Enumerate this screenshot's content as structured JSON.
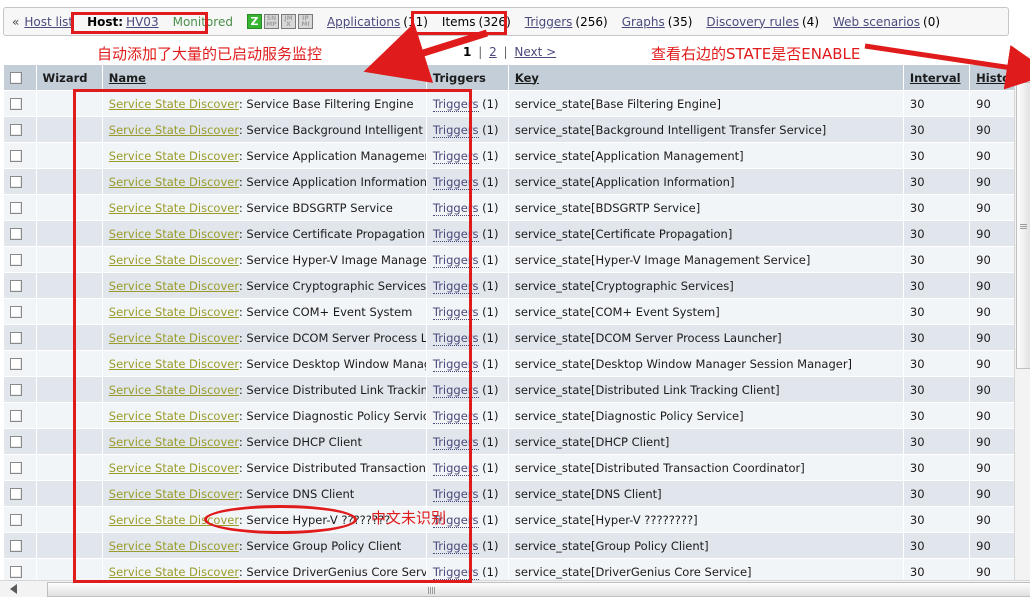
{
  "nav": {
    "back_chevron": "«",
    "host_list": "Host list",
    "host_label": "Host:",
    "host_name": "HV03",
    "monitored": "Monitored",
    "icons": [
      {
        "name": "zbx-icon",
        "label": "Z",
        "active": true
      },
      {
        "name": "snmp-icon",
        "label": "SNMP",
        "active": false
      },
      {
        "name": "jmx-icon",
        "label": "JMX",
        "active": false
      },
      {
        "name": "ipmi-icon",
        "label": "IPMI",
        "active": false
      }
    ],
    "tabs": [
      {
        "label": "Applications",
        "count": "(11)"
      },
      {
        "label": "Items",
        "count": "(326)"
      },
      {
        "label": "Triggers",
        "count": "(256)"
      },
      {
        "label": "Graphs",
        "count": "(35)"
      },
      {
        "label": "Discovery rules",
        "count": "(4)"
      },
      {
        "label": "Web scenarios",
        "count": "(0)"
      }
    ]
  },
  "paging": {
    "page1": "1",
    "sep1": "|",
    "page2": "2",
    "sep2": "|",
    "next": "Next >"
  },
  "table": {
    "headers": {
      "wizard": "Wizard",
      "name": "Name",
      "triggers": "Triggers",
      "key": "Key",
      "interval": "Interval",
      "history": "Histo"
    },
    "rows": [
      {
        "prefix": "Service State Discover",
        "sep": ": ",
        "name": "Service Base Filtering Engine",
        "triggers": "Triggers",
        "trigger_count": "(1)",
        "key": "service_state[Base Filtering Engine]",
        "interval": "30",
        "history": "90"
      },
      {
        "prefix": "Service State Discover",
        "sep": ": ",
        "name": "Service Background Intelligent Transfer Service",
        "triggers": "Triggers",
        "trigger_count": "(1)",
        "key": "service_state[Background Intelligent Transfer Service]",
        "interval": "30",
        "history": "90"
      },
      {
        "prefix": "Service State Discover",
        "sep": ": ",
        "name": "Service Application Management",
        "triggers": "Triggers",
        "trigger_count": "(1)",
        "key": "service_state[Application Management]",
        "interval": "30",
        "history": "90"
      },
      {
        "prefix": "Service State Discover",
        "sep": ": ",
        "name": "Service Application Information",
        "triggers": "Triggers",
        "trigger_count": "(1)",
        "key": "service_state[Application Information]",
        "interval": "30",
        "history": "90"
      },
      {
        "prefix": "Service State Discover",
        "sep": ": ",
        "name": "Service BDSGRTP Service",
        "triggers": "Triggers",
        "trigger_count": "(1)",
        "key": "service_state[BDSGRTP Service]",
        "interval": "30",
        "history": "90"
      },
      {
        "prefix": "Service State Discover",
        "sep": ": ",
        "name": "Service Certificate Propagation",
        "triggers": "Triggers",
        "trigger_count": "(1)",
        "key": "service_state[Certificate Propagation]",
        "interval": "30",
        "history": "90"
      },
      {
        "prefix": "Service State Discover",
        "sep": ": ",
        "name": "Service Hyper-V Image Management Service",
        "triggers": "Triggers",
        "trigger_count": "(1)",
        "key": "service_state[Hyper-V Image Management Service]",
        "interval": "30",
        "history": "90"
      },
      {
        "prefix": "Service State Discover",
        "sep": ": ",
        "name": "Service Cryptographic Services",
        "triggers": "Triggers",
        "trigger_count": "(1)",
        "key": "service_state[Cryptographic Services]",
        "interval": "30",
        "history": "90"
      },
      {
        "prefix": "Service State Discover",
        "sep": ": ",
        "name": "Service COM+ Event System",
        "triggers": "Triggers",
        "trigger_count": "(1)",
        "key": "service_state[COM+ Event System]",
        "interval": "30",
        "history": "90"
      },
      {
        "prefix": "Service State Discover",
        "sep": ": ",
        "name": "Service DCOM Server Process Launcher",
        "triggers": "Triggers",
        "trigger_count": "(1)",
        "key": "service_state[DCOM Server Process Launcher]",
        "interval": "30",
        "history": "90"
      },
      {
        "prefix": "Service State Discover",
        "sep": ": ",
        "name": "Service Desktop Window Manager Session Manager",
        "triggers": "Triggers",
        "trigger_count": "(1)",
        "key": "service_state[Desktop Window Manager Session Manager]",
        "interval": "30",
        "history": "90"
      },
      {
        "prefix": "Service State Discover",
        "sep": ": ",
        "name": "Service Distributed Link Tracking Client",
        "triggers": "Triggers",
        "trigger_count": "(1)",
        "key": "service_state[Distributed Link Tracking Client]",
        "interval": "30",
        "history": "90"
      },
      {
        "prefix": "Service State Discover",
        "sep": ": ",
        "name": "Service Diagnostic Policy Service",
        "triggers": "Triggers",
        "trigger_count": "(1)",
        "key": "service_state[Diagnostic Policy Service]",
        "interval": "30",
        "history": "90"
      },
      {
        "prefix": "Service State Discover",
        "sep": ": ",
        "name": "Service DHCP Client",
        "triggers": "Triggers",
        "trigger_count": "(1)",
        "key": "service_state[DHCP Client]",
        "interval": "30",
        "history": "90"
      },
      {
        "prefix": "Service State Discover",
        "sep": ": ",
        "name": "Service Distributed Transaction Coordinator",
        "triggers": "Triggers",
        "trigger_count": "(1)",
        "key": "service_state[Distributed Transaction Coordinator]",
        "interval": "30",
        "history": "90"
      },
      {
        "prefix": "Service State Discover",
        "sep": ": ",
        "name": "Service DNS Client",
        "triggers": "Triggers",
        "trigger_count": "(1)",
        "key": "service_state[DNS Client]",
        "interval": "30",
        "history": "90"
      },
      {
        "prefix": "Service State Discover",
        "sep": ": ",
        "name": "Service Hyper-V ????????",
        "triggers": "Triggers",
        "trigger_count": "(1)",
        "key": "service_state[Hyper-V ????????]",
        "interval": "30",
        "history": "90"
      },
      {
        "prefix": "Service State Discover",
        "sep": ": ",
        "name": "Service Group Policy Client",
        "triggers": "Triggers",
        "trigger_count": "(1)",
        "key": "service_state[Group Policy Client]",
        "interval": "30",
        "history": "90"
      },
      {
        "prefix": "Service State Discover",
        "sep": ": ",
        "name": "Service DriverGenius Core Service",
        "triggers": "Triggers",
        "trigger_count": "(1)",
        "key": "service_state[DriverGenius Core Service]",
        "interval": "30",
        "history": "90"
      }
    ]
  },
  "annotations": {
    "color": "#e01b1b",
    "note_left": "自动添加了大量的已启动服务监控",
    "note_right": "查看右边的STATE是否ENABLE",
    "note_cn_unrecognized": "中文未识别"
  }
}
